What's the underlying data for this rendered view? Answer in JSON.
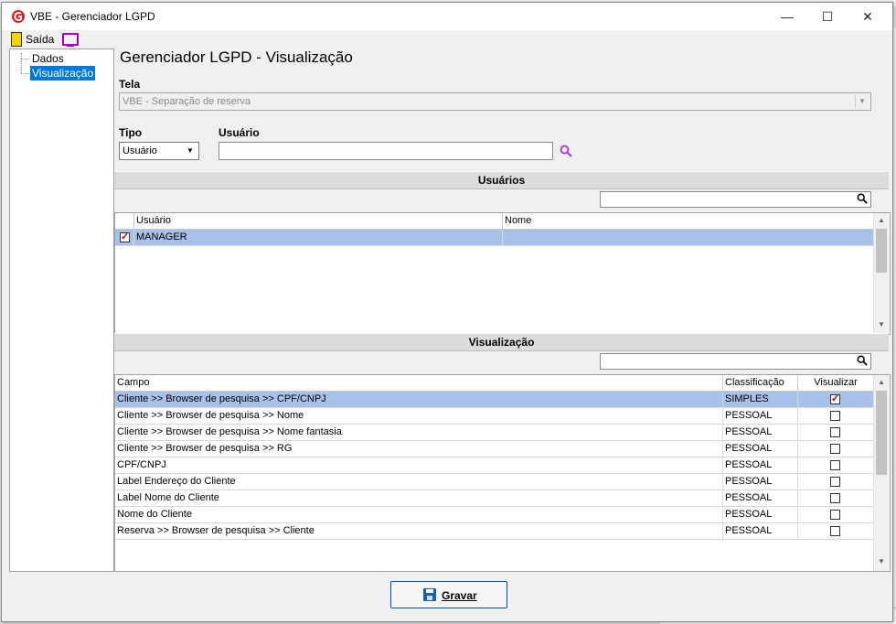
{
  "window": {
    "title": "VBE - Gerenciador LGPD",
    "minimize": "—",
    "maximize": "☐",
    "close": "✕"
  },
  "toolbar": {
    "exit_label": "Saída"
  },
  "tree": {
    "items": [
      "Dados",
      "Visualização"
    ],
    "selected": "Visualização"
  },
  "main": {
    "title": "Gerenciador LGPD - Visualização"
  },
  "form": {
    "tela_label": "Tela",
    "tela_value": "VBE - Separação de reserva",
    "tipo_label": "Tipo",
    "tipo_value": "Usuário",
    "usuario_label": "Usuário",
    "usuario_value": ""
  },
  "usuarios": {
    "section_title": "Usuários",
    "search_value": "",
    "columns": [
      "Usuário",
      "Nome"
    ],
    "rows": [
      {
        "checked": true,
        "usuario": "MANAGER",
        "nome": ""
      }
    ]
  },
  "visualizacao": {
    "section_title": "Visualização",
    "search_value": "",
    "columns": [
      "Campo",
      "Classificação",
      "Visualizar"
    ],
    "rows": [
      {
        "campo": "Cliente >> Browser de pesquisa >> CPF/CNPJ",
        "classificacao": "SIMPLES",
        "visualizar": true
      },
      {
        "campo": "Cliente >> Browser de pesquisa >> Nome",
        "classificacao": "PESSOAL",
        "visualizar": false
      },
      {
        "campo": "Cliente >> Browser de pesquisa >> Nome fantasia",
        "classificacao": "PESSOAL",
        "visualizar": false
      },
      {
        "campo": "Cliente >> Browser de pesquisa >> RG",
        "classificacao": "PESSOAL",
        "visualizar": false
      },
      {
        "campo": "CPF/CNPJ",
        "classificacao": "PESSOAL",
        "visualizar": false
      },
      {
        "campo": "Label Endereço do Cliente",
        "classificacao": "PESSOAL",
        "visualizar": false
      },
      {
        "campo": "Label Nome do Cliente",
        "classificacao": "PESSOAL",
        "visualizar": false
      },
      {
        "campo": "Nome do Cliente",
        "classificacao": "PESSOAL",
        "visualizar": false
      },
      {
        "campo": "Reserva >> Browser de pesquisa >> Cliente",
        "classificacao": "PESSOAL",
        "visualizar": false
      }
    ]
  },
  "footer": {
    "save_label": "Gravar"
  },
  "colors": {
    "selection": "#a8c1e8",
    "tree_selection": "#0078d7",
    "check_red": "#d00000",
    "search_icon_purple": "#b040e0"
  }
}
